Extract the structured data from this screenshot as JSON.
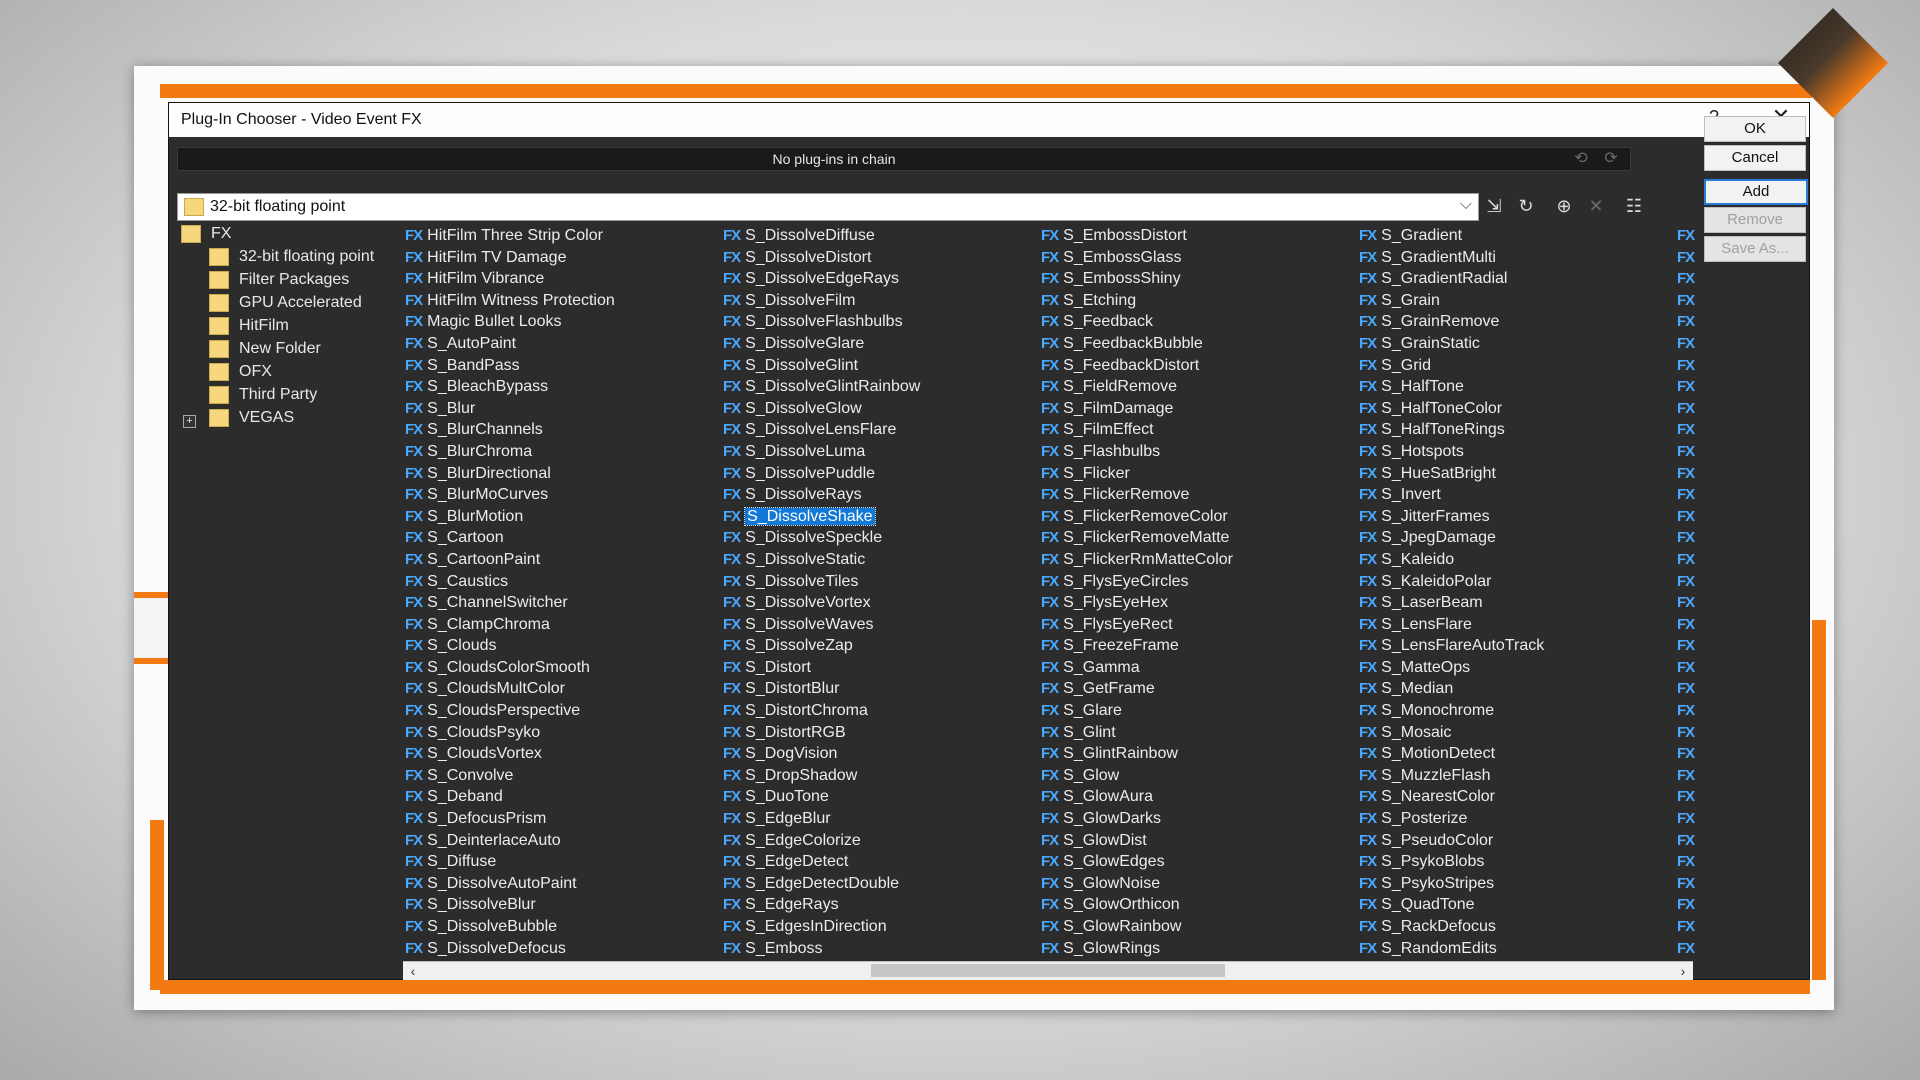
{
  "dialog": {
    "title": "Plug-In Chooser - Video Event FX",
    "help_label": "?",
    "close_label": "✕"
  },
  "chain": {
    "status": "No plug-ins in chain"
  },
  "buttons": {
    "ok": "OK",
    "cancel": "Cancel",
    "add": "Add",
    "remove": "Remove",
    "save_as": "Save As..."
  },
  "filter": {
    "selected": "32-bit floating point"
  },
  "tree": {
    "root": "FX",
    "items": [
      "32-bit floating point",
      "Filter Packages",
      "GPU Accelerated",
      "HitFilm",
      "New Folder",
      "OFX",
      "Third Party",
      "VEGAS"
    ]
  },
  "fx_badge": "FX",
  "selected_plugin": "S_DissolveShake",
  "plugins": {
    "col1": [
      "HitFilm Three Strip Color",
      "HitFilm TV Damage",
      "HitFilm Vibrance",
      "HitFilm Witness Protection",
      "Magic Bullet Looks",
      "S_AutoPaint",
      "S_BandPass",
      "S_BleachBypass",
      "S_Blur",
      "S_BlurChannels",
      "S_BlurChroma",
      "S_BlurDirectional",
      "S_BlurMoCurves",
      "S_BlurMotion",
      "S_Cartoon",
      "S_CartoonPaint",
      "S_Caustics",
      "S_ChannelSwitcher",
      "S_ClampChroma",
      "S_Clouds",
      "S_CloudsColorSmooth",
      "S_CloudsMultColor",
      "S_CloudsPerspective",
      "S_CloudsPsyko",
      "S_CloudsVortex",
      "S_Convolve",
      "S_Deband",
      "S_DefocusPrism",
      "S_DeinterlaceAuto",
      "S_Diffuse",
      "S_DissolveAutoPaint",
      "S_DissolveBlur",
      "S_DissolveBubble",
      "S_DissolveDefocus"
    ],
    "col2": [
      "S_DissolveDiffuse",
      "S_DissolveDistort",
      "S_DissolveEdgeRays",
      "S_DissolveFilm",
      "S_DissolveFlashbulbs",
      "S_DissolveGlare",
      "S_DissolveGlint",
      "S_DissolveGlintRainbow",
      "S_DissolveGlow",
      "S_DissolveLensFlare",
      "S_DissolveLuma",
      "S_DissolvePuddle",
      "S_DissolveRays",
      "S_DissolveShake",
      "S_DissolveSpeckle",
      "S_DissolveStatic",
      "S_DissolveTiles",
      "S_DissolveVortex",
      "S_DissolveWaves",
      "S_DissolveZap",
      "S_Distort",
      "S_DistortBlur",
      "S_DistortChroma",
      "S_DistortRGB",
      "S_DogVision",
      "S_DropShadow",
      "S_DuoTone",
      "S_EdgeBlur",
      "S_EdgeColorize",
      "S_EdgeDetect",
      "S_EdgeDetectDouble",
      "S_EdgeRays",
      "S_EdgesInDirection",
      "S_Emboss"
    ],
    "col3": [
      "S_EmbossDistort",
      "S_EmbossGlass",
      "S_EmbossShiny",
      "S_Etching",
      "S_Feedback",
      "S_FeedbackBubble",
      "S_FeedbackDistort",
      "S_FieldRemove",
      "S_FilmDamage",
      "S_FilmEffect",
      "S_Flashbulbs",
      "S_Flicker",
      "S_FlickerRemove",
      "S_FlickerRemoveColor",
      "S_FlickerRemoveMatte",
      "S_FlickerRmMatteColor",
      "S_FlysEyeCircles",
      "S_FlysEyeHex",
      "S_FlysEyeRect",
      "S_FreezeFrame",
      "S_Gamma",
      "S_GetFrame",
      "S_Glare",
      "S_Glint",
      "S_GlintRainbow",
      "S_Glow",
      "S_GlowAura",
      "S_GlowDarks",
      "S_GlowDist",
      "S_GlowEdges",
      "S_GlowNoise",
      "S_GlowOrthicon",
      "S_GlowRainbow",
      "S_GlowRings"
    ],
    "col4": [
      "S_Gradient",
      "S_GradientMulti",
      "S_GradientRadial",
      "S_Grain",
      "S_GrainRemove",
      "S_GrainStatic",
      "S_Grid",
      "S_HalfTone",
      "S_HalfToneColor",
      "S_HalfToneRings",
      "S_Hotspots",
      "S_HueSatBright",
      "S_Invert",
      "S_JitterFrames",
      "S_JpegDamage",
      "S_Kaleido",
      "S_KaleidoPolar",
      "S_LaserBeam",
      "S_LensFlare",
      "S_LensFlareAutoTrack",
      "S_MatteOps",
      "S_Median",
      "S_Monochrome",
      "S_Mosaic",
      "S_MotionDetect",
      "S_MuzzleFlash",
      "S_NearestColor",
      "S_Posterize",
      "S_PseudoColor",
      "S_PsykoBlobs",
      "S_PsykoStripes",
      "S_QuadTone",
      "S_RackDefocus",
      "S_RandomEdits"
    ]
  },
  "icons": {
    "chain_undo": "undo-icon",
    "chain_redo": "redo-icon",
    "load_preset": "load-preset-icon",
    "refresh": "refresh-icon",
    "new_folder": "new-folder-icon",
    "delete": "delete-icon",
    "view": "view-mode-icon"
  },
  "colors": {
    "accent": "#f37a12",
    "fx_badge": "#4aa9ff",
    "selection": "#1479d6"
  }
}
